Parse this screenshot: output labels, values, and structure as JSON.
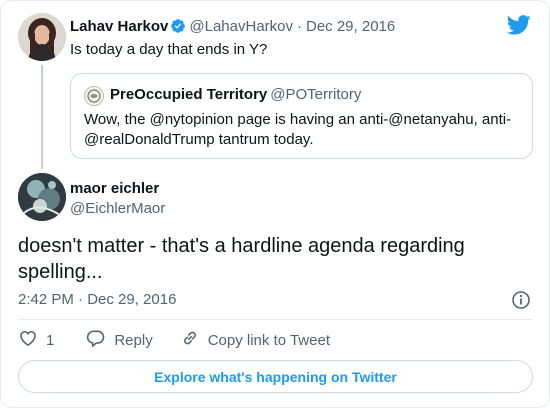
{
  "parent_tweet": {
    "author_name": "Lahav Harkov",
    "author_handle": "@LahavHarkov",
    "separator": "·",
    "date": "Dec 29, 2016",
    "text": "Is today a day that ends in Y?"
  },
  "quoted_tweet": {
    "author_name": "PreOccupied Territory",
    "author_handle": "@POTerritory",
    "text": "Wow, the @nytopinion page is having an anti-@netanyahu, anti-@realDonaldTrump tantrum today."
  },
  "main_tweet": {
    "author_name": "maor eichler",
    "author_handle": "@EichlerMaor",
    "text": "doesn't matter - that's a hardline agenda regarding spelling...",
    "timestamp": "2:42 PM · Dec 29, 2016"
  },
  "actions": {
    "like_count": "1",
    "reply_label": "Reply",
    "copy_link_label": "Copy link to Tweet"
  },
  "explore_button": {
    "label": "Explore what's happening on Twitter"
  },
  "colors": {
    "brand_blue": "#1d9bf0",
    "secondary_text": "#536471",
    "border": "#cfd9de"
  },
  "icons": {
    "brand": "twitter-bird-icon",
    "verified": "verified-badge-icon",
    "info": "info-icon",
    "like": "heart-icon",
    "reply": "reply-bubble-icon",
    "copy_link": "link-icon"
  }
}
